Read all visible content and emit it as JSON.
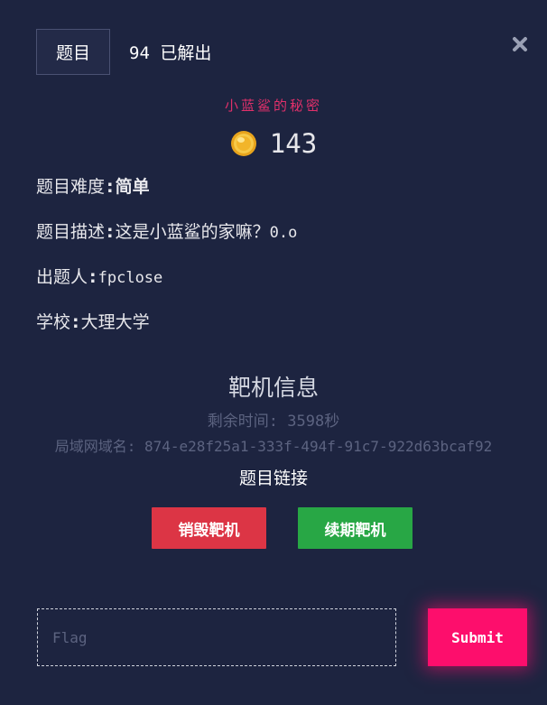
{
  "header": {
    "tab_label": "题目",
    "solves_label": "94 已解出"
  },
  "challenge": {
    "title": "小蓝鲨的秘密",
    "points": "143",
    "difficulty_label": "题目难度",
    "difficulty_value": "简单",
    "description_label": "题目描述",
    "description_value": "这是小蓝鲨的家嘛？",
    "description_suffix": "0.o",
    "author_label": "出题人",
    "author_value": "fpclose",
    "school_label": "学校",
    "school_value": "大理大学"
  },
  "target": {
    "title": "靶机信息",
    "remaining": "剩余时间: 3598秒",
    "domain": "局域网域名: 874-e28f25a1-333f-494f-91c7-922d63bcaf92",
    "link_title": "题目链接",
    "destroy_label": "销毁靶机",
    "renew_label": "续期靶机"
  },
  "submission": {
    "placeholder": "Flag",
    "submit_label": "Submit"
  },
  "colors": {
    "background": "#1d2440",
    "title_pink": "#e0306a",
    "destroy_red": "#dc3545",
    "renew_green": "#28a745",
    "submit_pink": "#fd0e6c"
  },
  "icons": {
    "close": "close-icon",
    "coin": "coin-icon"
  }
}
